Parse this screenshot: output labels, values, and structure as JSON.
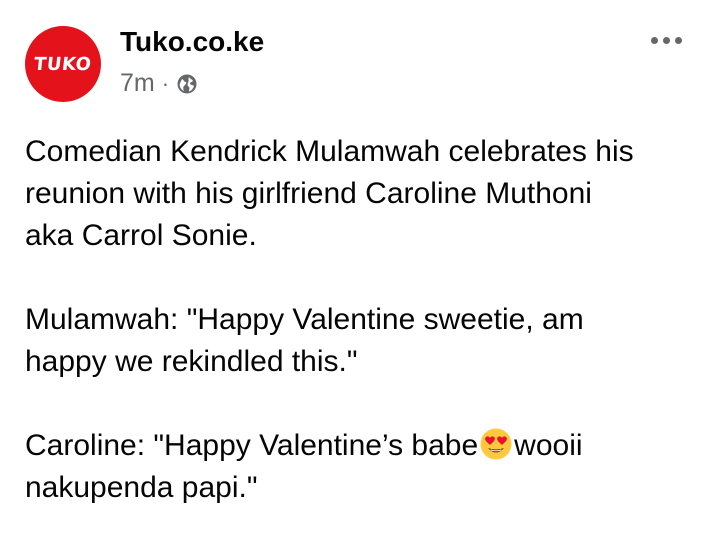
{
  "post": {
    "page_name": "Tuko.co.ke",
    "avatar_text": "TUKO",
    "time": "7m",
    "separator": "·",
    "audience_icon": "globe-icon",
    "more_icon": "more-options-icon",
    "paragraphs": [
      {
        "lines": [
          "Comedian Kendrick Mulamwah celebrates his",
          "reunion with his girlfriend Caroline Muthoni",
          "aka Carrol Sonie."
        ]
      },
      {
        "lines": [
          "Mulamwah: \"Happy Valentine sweetie, am",
          "happy we rekindled this.\""
        ]
      },
      {
        "line1_before_emoji": "Caroline: \"Happy Valentine’s babe",
        "emoji": "heart-eyes-emoji",
        "line1_after_emoji": "wooii",
        "line2": "nakupenda papi.\""
      }
    ]
  },
  "colors": {
    "brand_red": "#e3121b",
    "text": "#050505",
    "secondary_text": "#65676b"
  }
}
